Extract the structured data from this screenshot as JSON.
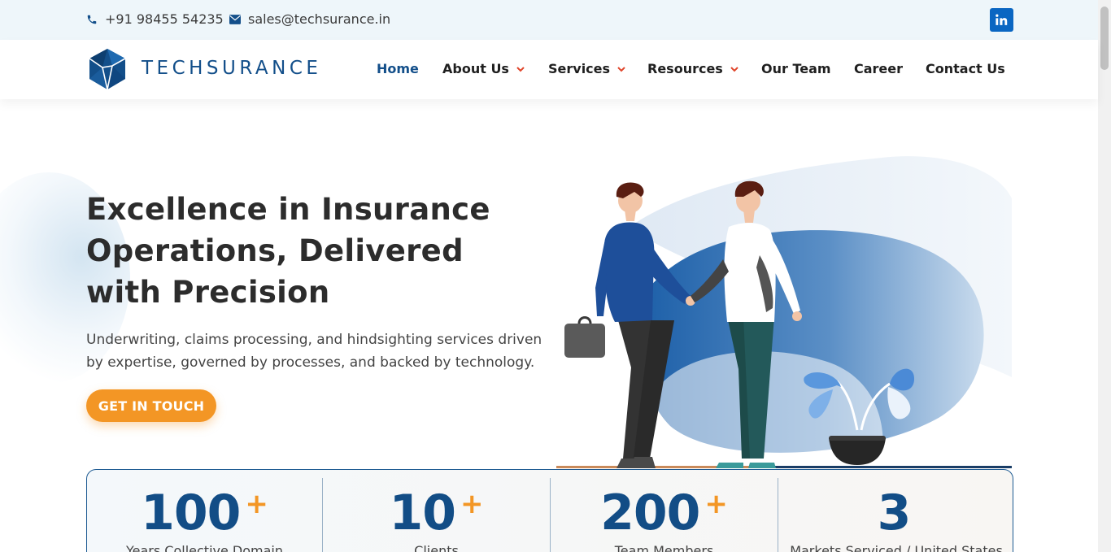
{
  "topbar": {
    "phone": "+91 98455 54235",
    "email": "sales@techsurance.in",
    "social": "linkedin-icon"
  },
  "brand": {
    "name": "TECHSURANCE",
    "logo_color": "#134f8a"
  },
  "nav": {
    "items": [
      {
        "label": "Home",
        "active": true,
        "dropdown": false
      },
      {
        "label": "About Us",
        "active": false,
        "dropdown": true
      },
      {
        "label": "Services",
        "active": false,
        "dropdown": true
      },
      {
        "label": "Resources",
        "active": false,
        "dropdown": true
      },
      {
        "label": "Our Team",
        "active": false,
        "dropdown": false
      },
      {
        "label": "Career",
        "active": false,
        "dropdown": false
      },
      {
        "label": "Contact Us",
        "active": false,
        "dropdown": false
      }
    ]
  },
  "hero": {
    "title_line1": "Excellence in Insurance",
    "title_line2": "Operations, Delivered",
    "title_line3": "with Precision",
    "subtitle": "Underwriting, claims processing, and hindsighting services driven by expertise, governed by processes, and backed by technology.",
    "cta_label": "GET IN TOUCH",
    "illustration": "handshake-illustration"
  },
  "stats": [
    {
      "value": "100",
      "plus": "+",
      "label": "Years Collective Domain"
    },
    {
      "value": "10",
      "plus": "+",
      "label": "Clients"
    },
    {
      "value": "200",
      "plus": "+",
      "label": "Team Members"
    },
    {
      "value": "3",
      "plus": "",
      "label": "Markets Serviced / United States"
    }
  ],
  "colors": {
    "primary": "#134f8a",
    "accent": "#f39625",
    "topbar_bg": "#eef6fa"
  }
}
